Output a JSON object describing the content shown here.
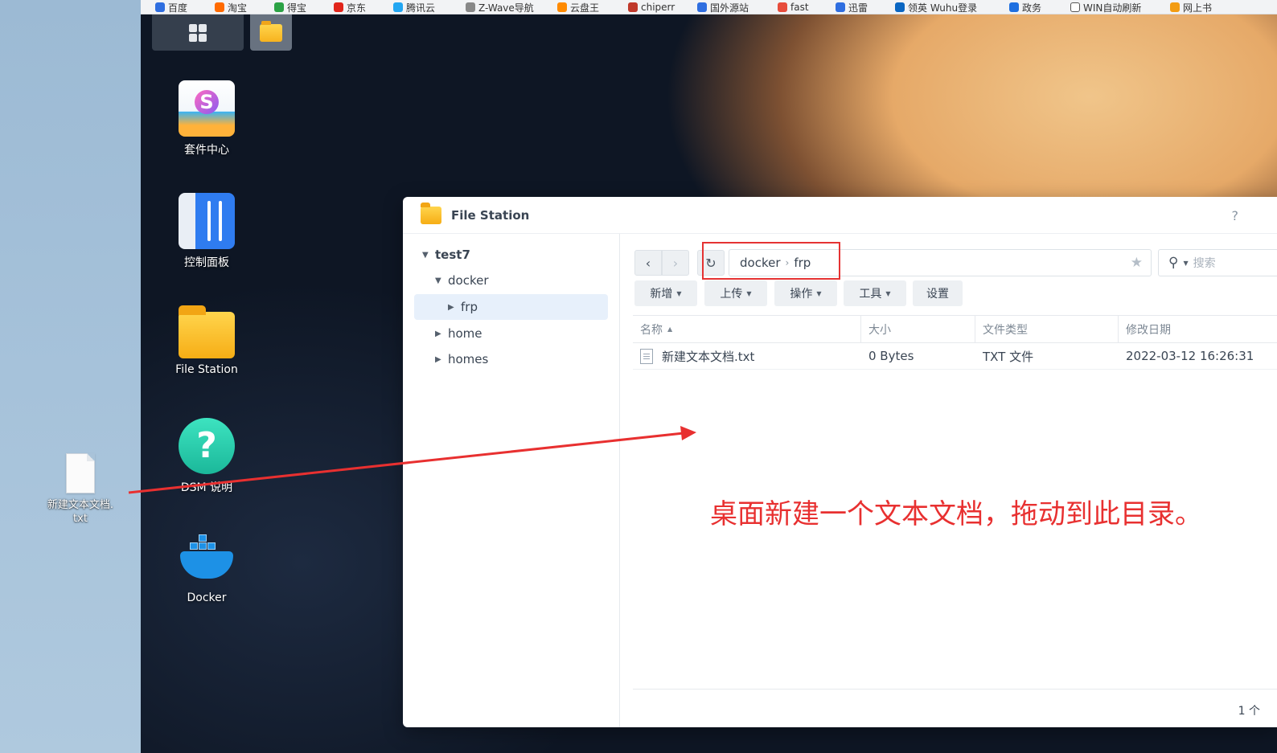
{
  "browser": {
    "bookmarks": [
      "百度",
      "淘宝",
      "得宝",
      "京东",
      "腾讯云",
      "Z-Wave导航",
      "云盘王",
      "chiperr",
      "国外源站",
      "fast",
      "迅雷",
      "领英 Wuhu登录",
      "政务",
      "WIN自动刷新",
      "网上书"
    ]
  },
  "host_desktop": {
    "file_label": "新建文本文档.txt"
  },
  "dsm_desktop": {
    "apps": [
      {
        "label": "套件中心",
        "icon": "package-center-icon"
      },
      {
        "label": "控制面板",
        "icon": "control-panel-icon"
      },
      {
        "label": "File Station",
        "icon": "folder-icon"
      },
      {
        "label": "DSM 说明",
        "icon": "help-icon"
      },
      {
        "label": "Docker",
        "icon": "docker-icon"
      }
    ]
  },
  "file_station": {
    "title": "File Station",
    "help": "?",
    "tree": {
      "root": "test7",
      "items": [
        "docker",
        "frp",
        "home",
        "homes"
      ]
    },
    "path": {
      "parts": [
        "docker",
        "frp"
      ],
      "search_placeholder": "搜索"
    },
    "toolbar": {
      "new": "新增",
      "upload": "上传",
      "action": "操作",
      "tools": "工具",
      "settings": "设置"
    },
    "columns": [
      "名称",
      "大小",
      "文件类型",
      "修改日期"
    ],
    "rows": [
      {
        "name": "新建文本文档.txt",
        "size": "0 Bytes",
        "type": "TXT 文件",
        "modified": "2022-03-12 16:26:31"
      }
    ],
    "count": "1 个"
  },
  "annotation": {
    "text": "桌面新建一个文本文档，拖动到此目录。",
    "color": "#e83030"
  }
}
